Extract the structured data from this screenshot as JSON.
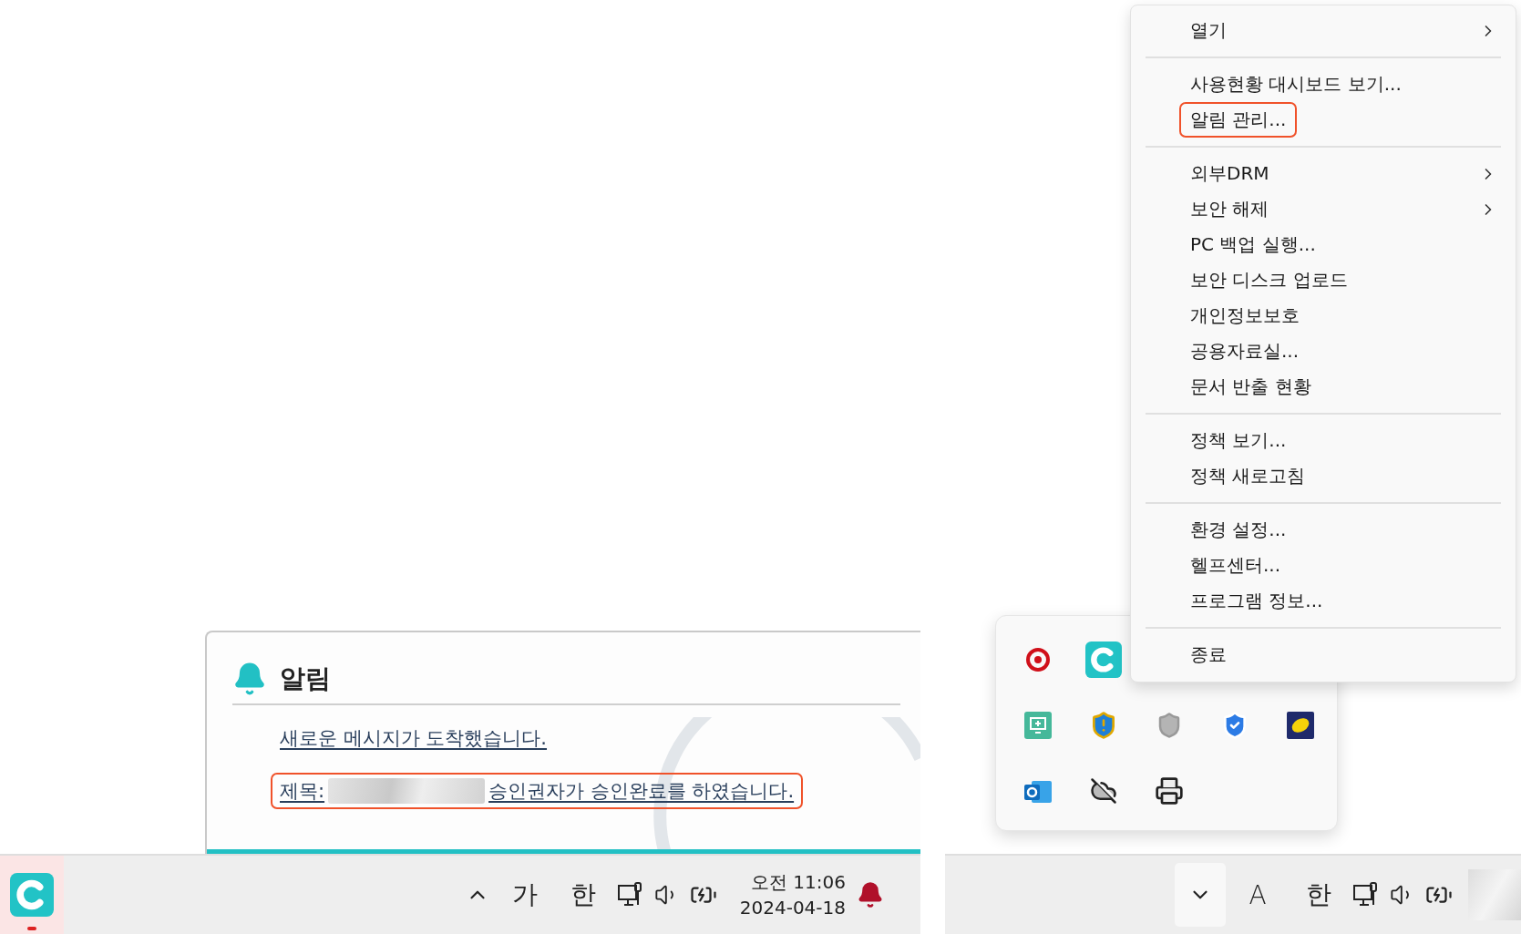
{
  "left_screen": {
    "notification": {
      "title": "알림",
      "messages": [
        {
          "text": "새로운 메시지가 도착했습니다.",
          "redacted": false,
          "highlighted": false
        },
        {
          "prefix": "제목:",
          "text": "승인권자가 승인완료를 하였습니다.",
          "redacted": true,
          "highlighted": true
        }
      ]
    },
    "taskbar": {
      "ime_mode": "가",
      "ime_lang": "한",
      "clock_time": "오전 11:06",
      "clock_date": "2024-04-18"
    }
  },
  "right_screen": {
    "context_menu": {
      "groups": [
        {
          "items": [
            {
              "label": "열기",
              "submenu": true,
              "highlighted": false
            }
          ]
        },
        {
          "items": [
            {
              "label": "사용현황 대시보드 보기...",
              "submenu": false,
              "highlighted": false
            },
            {
              "label": "알림 관리...",
              "submenu": false,
              "highlighted": true
            }
          ]
        },
        {
          "items": [
            {
              "label": "외부DRM",
              "submenu": true,
              "highlighted": false
            },
            {
              "label": "보안 해제",
              "submenu": true,
              "highlighted": false
            },
            {
              "label": "PC 백업 실행...",
              "submenu": false,
              "highlighted": false
            },
            {
              "label": "보안 디스크 업로드",
              "submenu": false,
              "highlighted": false
            },
            {
              "label": "개인정보보호",
              "submenu": false,
              "highlighted": false
            },
            {
              "label": "공용자료실...",
              "submenu": false,
              "highlighted": false
            },
            {
              "label": "문서 반출 현황",
              "submenu": false,
              "highlighted": false
            }
          ]
        },
        {
          "items": [
            {
              "label": "정책 보기...",
              "submenu": false,
              "highlighted": false
            },
            {
              "label": "정책 새로고침",
              "submenu": false,
              "highlighted": false
            }
          ]
        },
        {
          "items": [
            {
              "label": "환경 설정...",
              "submenu": false,
              "highlighted": false
            },
            {
              "label": "헬프센터...",
              "submenu": false,
              "highlighted": false
            },
            {
              "label": "프로그램 정보...",
              "submenu": false,
              "highlighted": false
            }
          ]
        },
        {
          "items": [
            {
              "label": "종료",
              "submenu": false,
              "highlighted": false
            }
          ]
        }
      ]
    },
    "taskbar": {
      "ime_mode": "A",
      "ime_lang": "한"
    }
  }
}
